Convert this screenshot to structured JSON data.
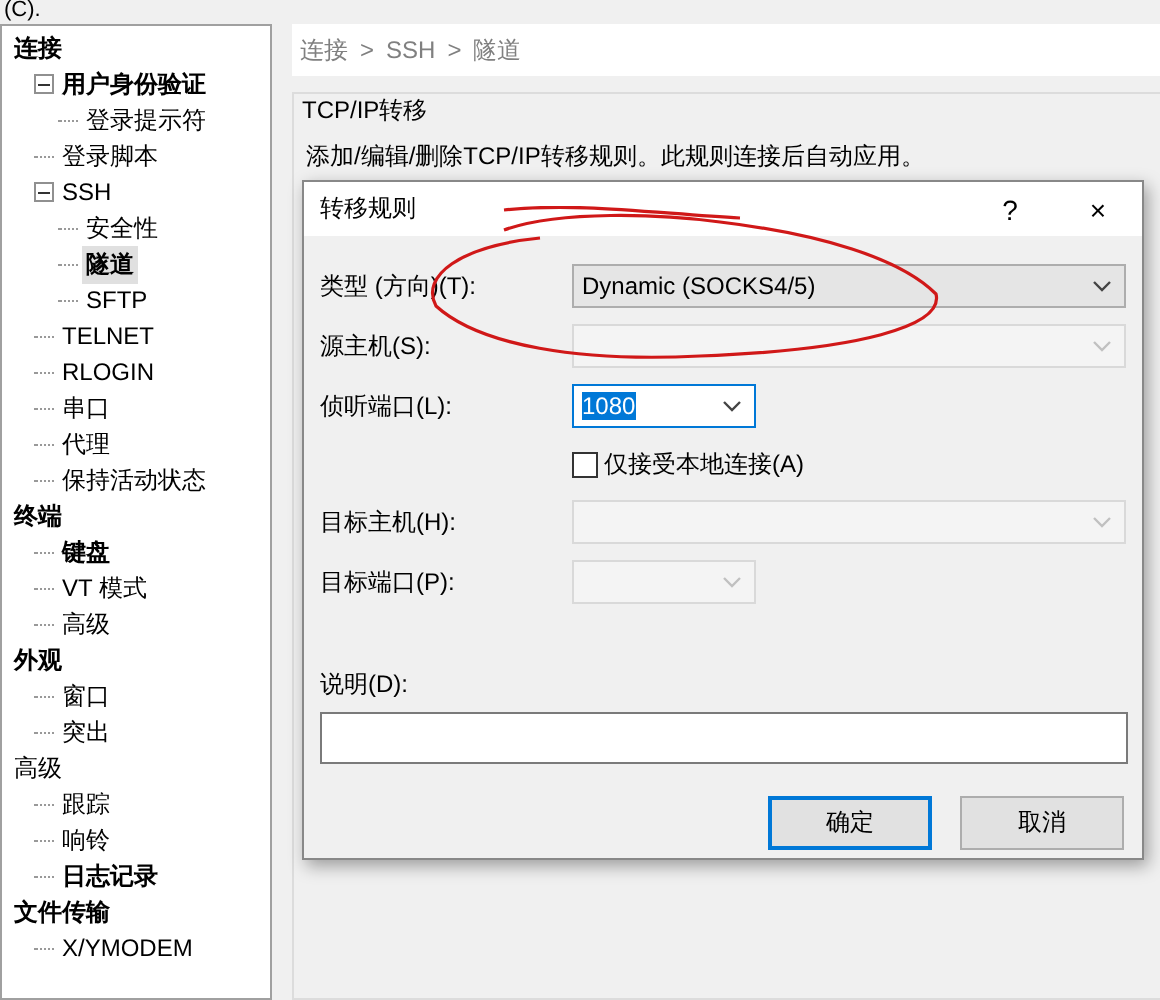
{
  "top_text": "(C).",
  "tree": [
    {
      "label": "连接",
      "bold": true,
      "selected": false,
      "children": [
        {
          "label": "用户身份验证",
          "bold": true,
          "selected": false,
          "children": [
            {
              "label": "登录提示符",
              "bold": false,
              "selected": false
            }
          ]
        },
        {
          "label": "登录脚本",
          "bold": false,
          "selected": false
        },
        {
          "label": "SSH",
          "bold": false,
          "selected": false,
          "children": [
            {
              "label": "安全性",
              "bold": false,
              "selected": false
            },
            {
              "label": "隧道",
              "bold": true,
              "selected": true
            },
            {
              "label": "SFTP",
              "bold": false,
              "selected": false
            }
          ]
        },
        {
          "label": "TELNET",
          "bold": false,
          "selected": false
        },
        {
          "label": "RLOGIN",
          "bold": false,
          "selected": false
        },
        {
          "label": "串口",
          "bold": false,
          "selected": false
        },
        {
          "label": "代理",
          "bold": false,
          "selected": false
        },
        {
          "label": "保持活动状态",
          "bold": false,
          "selected": false
        }
      ]
    },
    {
      "label": "终端",
      "bold": true,
      "selected": false,
      "children": [
        {
          "label": "键盘",
          "bold": true,
          "selected": false
        },
        {
          "label": "VT 模式",
          "bold": false,
          "selected": false
        },
        {
          "label": "高级",
          "bold": false,
          "selected": false
        }
      ]
    },
    {
      "label": "外观",
      "bold": true,
      "selected": false,
      "children": [
        {
          "label": "窗口",
          "bold": false,
          "selected": false
        },
        {
          "label": "突出",
          "bold": false,
          "selected": false
        }
      ]
    },
    {
      "label": "高级",
      "bold": false,
      "selected": false,
      "children": [
        {
          "label": "跟踪",
          "bold": false,
          "selected": false
        },
        {
          "label": "响铃",
          "bold": false,
          "selected": false
        },
        {
          "label": "日志记录",
          "bold": true,
          "selected": false
        }
      ]
    },
    {
      "label": "文件传输",
      "bold": true,
      "selected": false,
      "children": [
        {
          "label": "X/YMODEM",
          "bold": false,
          "selected": false
        }
      ]
    }
  ],
  "breadcrumb": [
    "连接",
    "SSH",
    "隧道"
  ],
  "breadcrumb_separator": ">",
  "group_title": "TCP/IP转移",
  "description": "添加/编辑/删除TCP/IP转移规则。此规则连接后自动应用。",
  "dialog": {
    "title": "转移规则",
    "help": "?",
    "close": "×",
    "fields": [
      {
        "kind": "combo",
        "label": "类型 (方向)(T):",
        "value": "Dynamic (SOCKS4/5)",
        "disabled": false,
        "focused": false,
        "wide": true
      },
      {
        "kind": "combo",
        "label": "源主机(S):",
        "disabled": true,
        "focused": false,
        "wide": true
      },
      {
        "kind": "combo",
        "label": "侦听端口(L):",
        "value": "1080",
        "disabled": false,
        "focused": true,
        "wide": false
      },
      {
        "kind": "checkbox",
        "label": "仅接受本地连接(A)",
        "checked": false
      },
      {
        "kind": "combo",
        "label": "目标主机(H):",
        "disabled": true,
        "focused": false,
        "wide": true
      },
      {
        "kind": "combo",
        "label": "目标端口(P):",
        "disabled": true,
        "focused": false,
        "wide": false
      }
    ],
    "note_label": "说明(D):",
    "buttons": [
      {
        "label": "确定",
        "default": true
      },
      {
        "label": "取消",
        "default": false
      }
    ]
  }
}
